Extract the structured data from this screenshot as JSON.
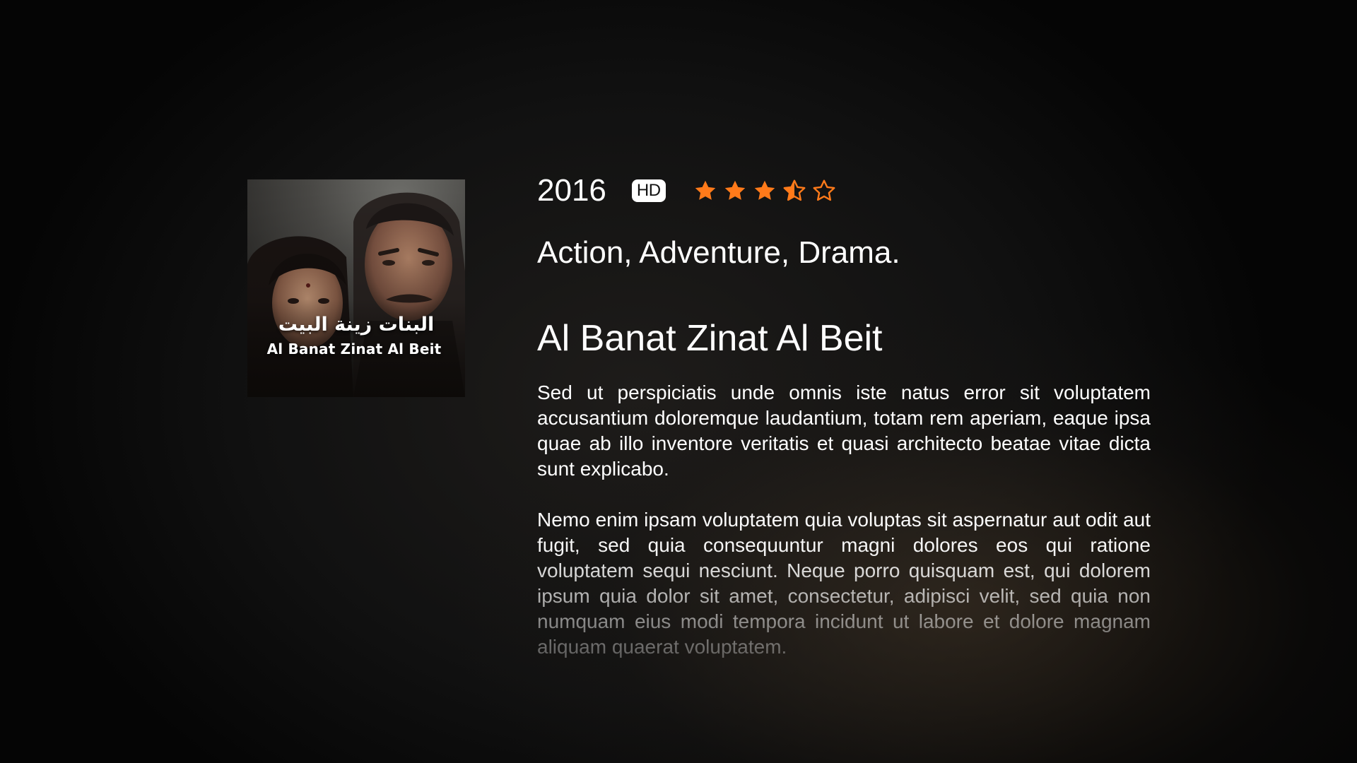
{
  "poster": {
    "icon": "movie-poster-image",
    "title_arabic": "البنات زينة البيت",
    "title_english": "Al Banat Zinat Al Beit"
  },
  "meta": {
    "year": "2016",
    "quality_badge": "HD",
    "rating": 3.5,
    "rating_max": 5,
    "star_color": "#ff7a1a"
  },
  "genres": "Action, Adventure, Drama.",
  "title": "Al Banat Zinat Al Beit",
  "description": {
    "paragraph_1": "Sed ut perspiciatis unde omnis iste natus error sit voluptatem accusantium doloremque laudantium, totam rem aperiam, eaque ipsa quae ab illo inventore veritatis et quasi architecto beatae vitae dicta sunt explicabo.",
    "paragraph_2": "Nemo enim ipsam voluptatem quia voluptas sit aspernatur aut odit aut fugit, sed quia consequuntur magni dolores eos qui ratione voluptatem sequi nesciunt. Neque porro quisquam est, qui dolorem ipsum quia dolor sit amet, consectetur, adipisci velit, sed quia non numquam eius modi tempora incidunt ut labore et dolore magnam aliquam quaerat voluptatem."
  }
}
